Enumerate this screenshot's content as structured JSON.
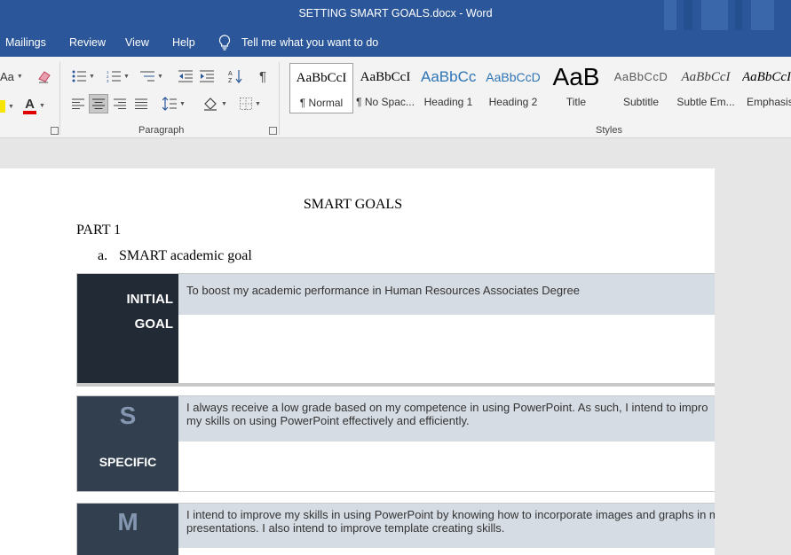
{
  "window": {
    "title": "SETTING SMART GOALS.docx  -  Word"
  },
  "menu": {
    "tabs": [
      "Mailings",
      "Review",
      "View",
      "Help"
    ],
    "tell_me": "Tell me what you want to do"
  },
  "ribbon": {
    "font_group": {
      "change_case": "Aa",
      "font_color": "A"
    },
    "paragraph_label": "Paragraph",
    "styles_label": "Styles",
    "styles": [
      {
        "sample": "AaBbCcI",
        "name": "¶ Normal"
      },
      {
        "sample": "AaBbCcI",
        "name": "¶ No Spac..."
      },
      {
        "sample": "AaBbCc",
        "name": "Heading 1"
      },
      {
        "sample": "AaBbCcD",
        "name": "Heading 2"
      },
      {
        "sample": "AaB",
        "name": "Title"
      },
      {
        "sample": "AaBbCcD",
        "name": "Subtitle"
      },
      {
        "sample": "AaBbCcI",
        "name": "Subtle Em..."
      },
      {
        "sample": "AaBbCcI",
        "name": "Emphasis"
      }
    ]
  },
  "document": {
    "title": "SMART GOALS",
    "part": "PART 1",
    "item_marker": "a.",
    "item_text": "SMART academic goal",
    "initial": {
      "label_line1": "INITIAL",
      "label_line2": "GOAL",
      "text": "To boost my academic performance in Human Resources Associates Degree"
    },
    "specific": {
      "letter": "S",
      "label": "SPECIFIC",
      "line1": " I always receive a low grade based on my competence in using PowerPoint. As such, I intend to impro",
      "line2": "my skills on using PowerPoint effectively and efficiently."
    },
    "measurable": {
      "letter": "M",
      "line1": "I intend to improve my skills in using PowerPoint by knowing how to incorporate images and graphs in m",
      "line2": "presentations. I also intend to improve template creating skills."
    }
  }
}
